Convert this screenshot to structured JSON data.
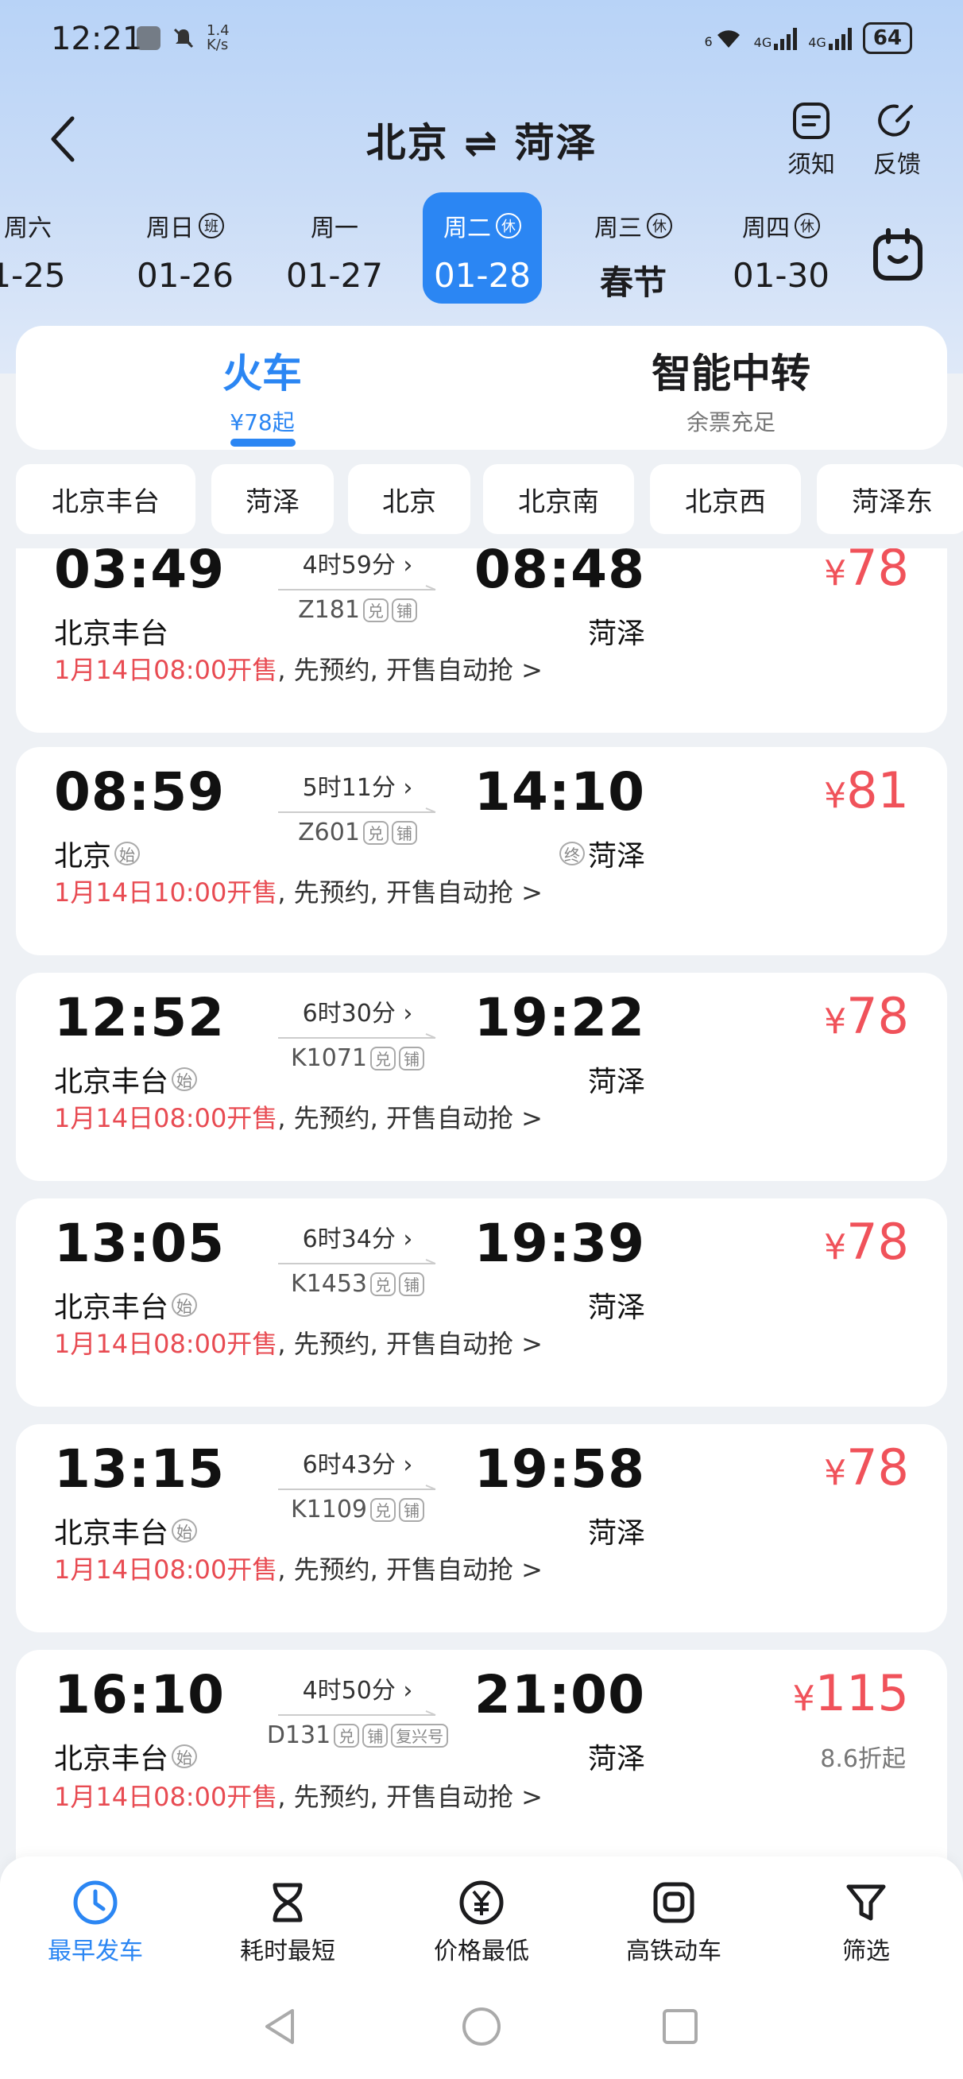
{
  "status_bar": {
    "time": "12:21",
    "speed_value": "1.4",
    "speed_unit": "K/s",
    "network_a": "4G",
    "network_b": "4G",
    "wifi_label": "6",
    "battery": "64"
  },
  "header": {
    "title": "北京 ⇌ 菏泽",
    "notice_label": "须知",
    "feedback_label": "反馈"
  },
  "dates": [
    {
      "weekday": "周六",
      "date": "1-25",
      "tag": ""
    },
    {
      "weekday": "周日",
      "date": "01-26",
      "tag": "班"
    },
    {
      "weekday": "周一",
      "date": "01-27",
      "tag": ""
    },
    {
      "weekday": "周二",
      "date": "01-28",
      "tag": "休"
    },
    {
      "weekday": "周三",
      "date": "春节",
      "tag": "休"
    },
    {
      "weekday": "周四",
      "date": "01-30",
      "tag": "休"
    }
  ],
  "modes": {
    "train": {
      "title": "火车",
      "sub": "¥78起"
    },
    "transfer": {
      "title": "智能中转",
      "sub": "余票充足"
    }
  },
  "stations": [
    "北京丰台",
    "菏泽",
    "北京",
    "北京南",
    "北京西",
    "菏泽东"
  ],
  "trains": [
    {
      "dep_time": "03:49",
      "dep_station": "北京丰台",
      "dep_tag": "",
      "duration": "4时59分 ›",
      "train_no": "Z181",
      "extra_badge": "",
      "arr_time": "08:48",
      "arr_station": "菏泽",
      "arr_tag": "",
      "price_symbol": "¥",
      "price": "78",
      "discount": "",
      "sale_red": "1月14日08:00开售",
      "sale_rest": ", 先预约, 开售自动抢 >"
    },
    {
      "dep_time": "08:59",
      "dep_station": "北京",
      "dep_tag": "始",
      "duration": "5时11分 ›",
      "train_no": "Z601",
      "extra_badge": "",
      "arr_time": "14:10",
      "arr_station": "菏泽",
      "arr_tag": "终",
      "price_symbol": "¥",
      "price": "81",
      "discount": "",
      "sale_red": "1月14日10:00开售",
      "sale_rest": ", 先预约, 开售自动抢 >"
    },
    {
      "dep_time": "12:52",
      "dep_station": "北京丰台",
      "dep_tag": "始",
      "duration": "6时30分 ›",
      "train_no": "K1071",
      "extra_badge": "",
      "arr_time": "19:22",
      "arr_station": "菏泽",
      "arr_tag": "",
      "price_symbol": "¥",
      "price": "78",
      "discount": "",
      "sale_red": "1月14日08:00开售",
      "sale_rest": ", 先预约, 开售自动抢 >"
    },
    {
      "dep_time": "13:05",
      "dep_station": "北京丰台",
      "dep_tag": "始",
      "duration": "6时34分 ›",
      "train_no": "K1453",
      "extra_badge": "",
      "arr_time": "19:39",
      "arr_station": "菏泽",
      "arr_tag": "",
      "price_symbol": "¥",
      "price": "78",
      "discount": "",
      "sale_red": "1月14日08:00开售",
      "sale_rest": ", 先预约, 开售自动抢 >"
    },
    {
      "dep_time": "13:15",
      "dep_station": "北京丰台",
      "dep_tag": "始",
      "duration": "6时43分 ›",
      "train_no": "K1109",
      "extra_badge": "",
      "arr_time": "19:58",
      "arr_station": "菏泽",
      "arr_tag": "",
      "price_symbol": "¥",
      "price": "78",
      "discount": "",
      "sale_red": "1月14日08:00开售",
      "sale_rest": ", 先预约, 开售自动抢 >"
    },
    {
      "dep_time": "16:10",
      "dep_station": "北京丰台",
      "dep_tag": "始",
      "duration": "4时50分 ›",
      "train_no": "D131",
      "extra_badge": "复兴号",
      "arr_time": "21:00",
      "arr_station": "菏泽",
      "arr_tag": "",
      "price_symbol": "¥",
      "price": "115",
      "discount": "8.6折起",
      "sale_red": "1月14日08:00开售",
      "sale_rest": ", 先预约, 开售自动抢 >"
    }
  ],
  "badges": {
    "exchange": "兑",
    "sleeper": "铺"
  },
  "sort_bar": {
    "earliest": "最早发车",
    "shortest": "耗时最短",
    "cheapest": "价格最低",
    "highspeed": "高铁动车",
    "filter": "筛选"
  },
  "colors": {
    "accent": "#2b86f3",
    "price": "#f0525a"
  }
}
